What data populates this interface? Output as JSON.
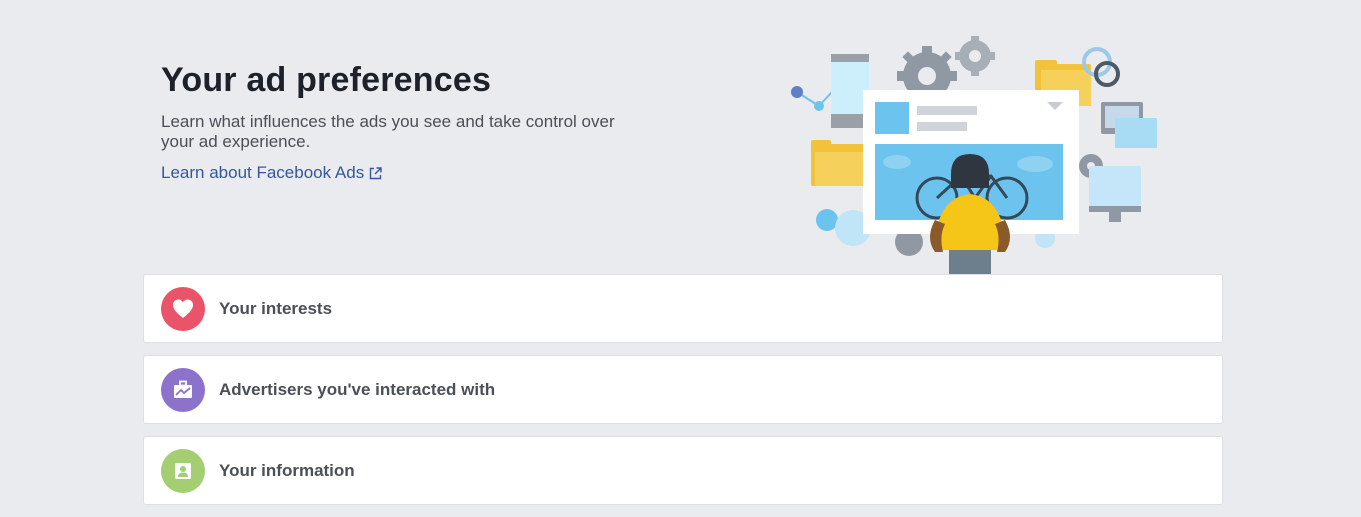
{
  "header": {
    "title": "Your ad preferences",
    "subtitle": "Learn what influences the ads you see and take control over your ad experience.",
    "link_label": "Learn about Facebook Ads",
    "link_icon": "external-link-icon"
  },
  "sections": [
    {
      "label": "Your interests",
      "icon": "heart-icon",
      "color": "#e9546b"
    },
    {
      "label": "Advertisers you've interacted with",
      "icon": "briefcase-icon",
      "color": "#8c72cb"
    },
    {
      "label": "Your information",
      "icon": "contact-card-icon",
      "color": "#a3ce71"
    }
  ],
  "colors": {
    "background": "#e9ebee",
    "link": "#365899",
    "title": "#1d2129",
    "card_text": "#4b4f56"
  }
}
